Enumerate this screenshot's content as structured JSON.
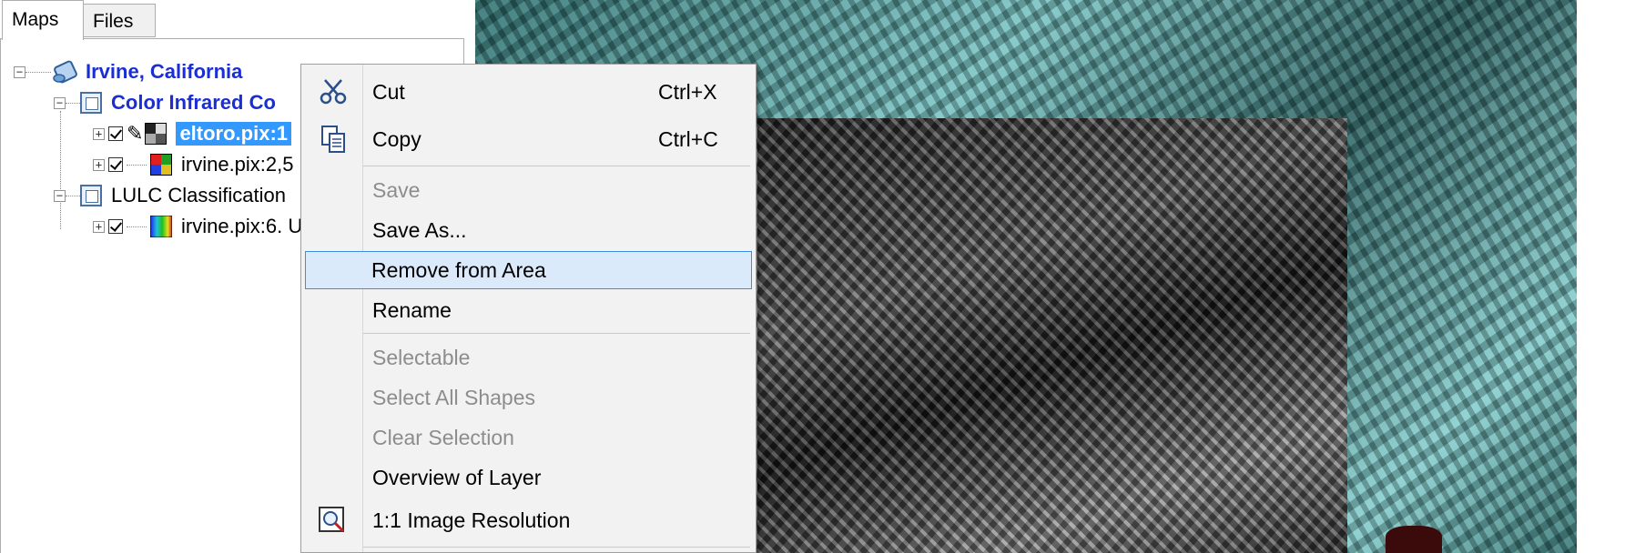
{
  "tabs": [
    {
      "label": "Maps",
      "active": true
    },
    {
      "label": "Files",
      "active": false
    }
  ],
  "tree": {
    "root": {
      "label": "Irvine, California",
      "icon": "map-scroll-icon"
    },
    "groups": [
      {
        "label": "Color Infrared Co",
        "layers": [
          {
            "label": "eltoro.pix:1",
            "checked": true,
            "selected": true,
            "icon": "grayscale-layer-icon"
          },
          {
            "label": "irvine.pix:2,5",
            "checked": true,
            "selected": false,
            "icon": "rgb-layer-icon"
          }
        ]
      },
      {
        "label": "LULC Classification",
        "layers": [
          {
            "label": "irvine.pix:6. U",
            "checked": true,
            "selected": false,
            "icon": "pseudocolor-layer-icon"
          }
        ]
      }
    ]
  },
  "context_menu": {
    "items": [
      {
        "label": "Cut",
        "shortcut": "Ctrl+X",
        "enabled": true,
        "icon": "scissors-icon"
      },
      {
        "label": "Copy",
        "shortcut": "Ctrl+C",
        "enabled": true,
        "icon": "copy-icon"
      },
      {
        "label": "Save",
        "enabled": false
      },
      {
        "label": "Save As...",
        "enabled": true
      },
      {
        "label": "Remove from Area",
        "enabled": true,
        "highlighted": true
      },
      {
        "label": "Rename",
        "enabled": true
      },
      {
        "label": "Selectable",
        "enabled": false
      },
      {
        "label": "Select All Shapes",
        "enabled": false
      },
      {
        "label": "Clear Selection",
        "enabled": false
      },
      {
        "label": "Overview of Layer",
        "enabled": true
      },
      {
        "label": "1:1 Image Resolution",
        "enabled": true,
        "icon": "zoom-resolution-icon"
      }
    ]
  },
  "colors": {
    "selection": "#3399ff",
    "group_label": "#1a2ed6",
    "menu_highlight": "#dbeafb",
    "menu_highlight_border": "#3d8ee8"
  }
}
